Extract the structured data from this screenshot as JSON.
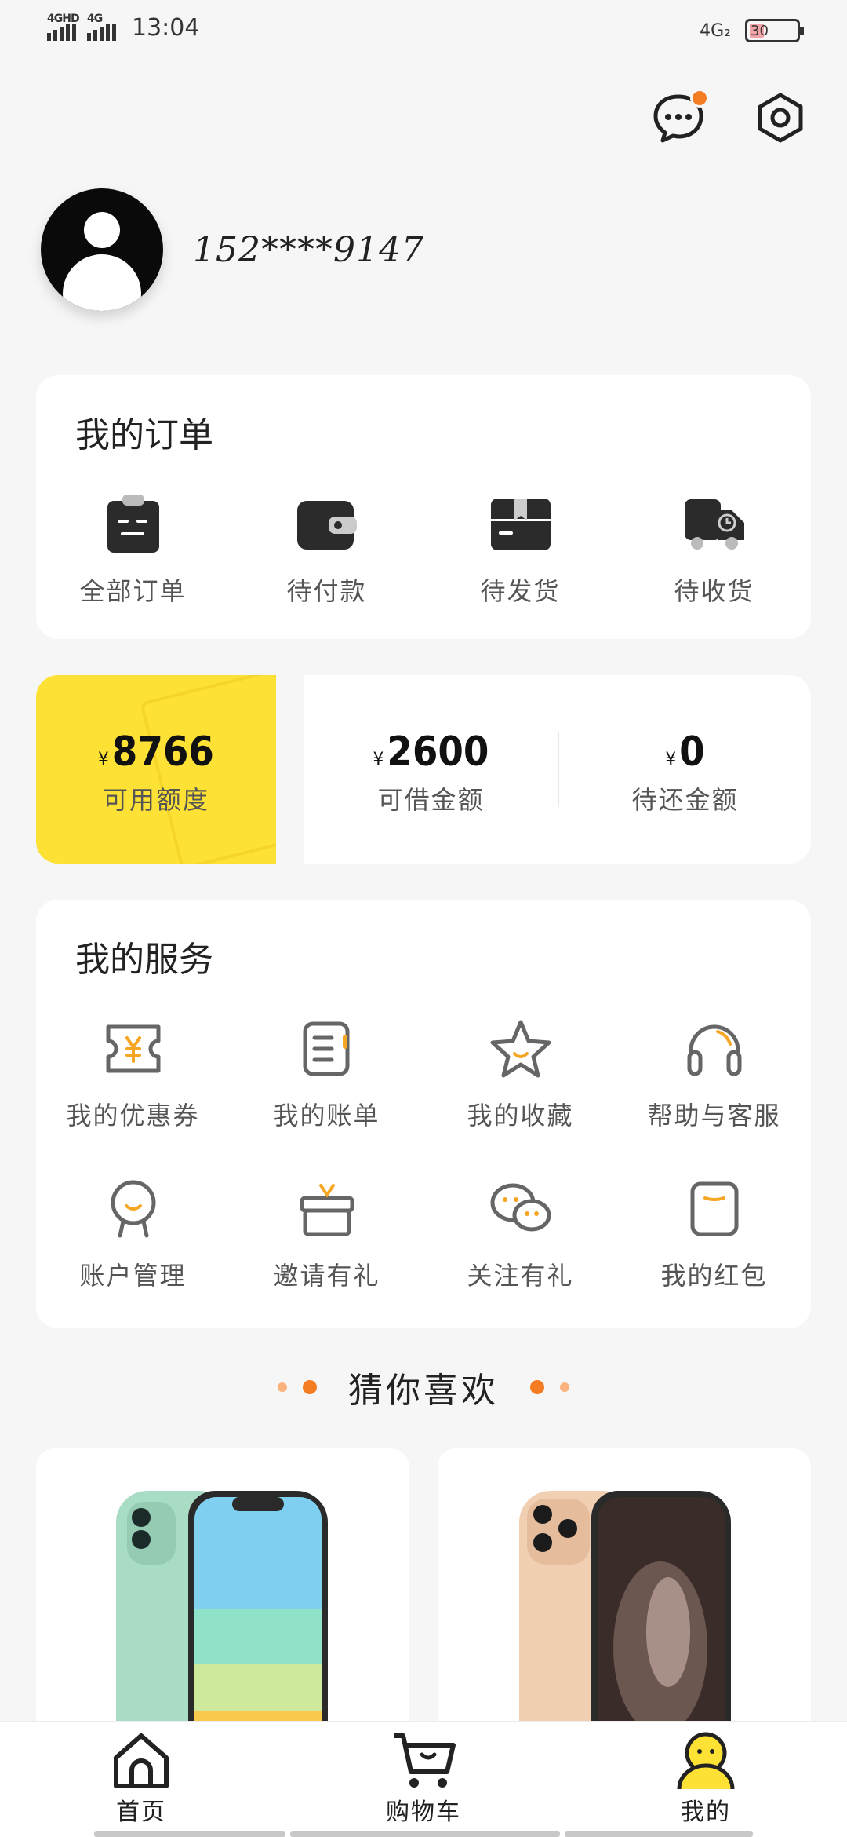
{
  "status_bar": {
    "net1": "4GHD",
    "net2": "4G",
    "time": "13:04",
    "net_right": "4G₂",
    "battery": "30"
  },
  "header": {
    "message_icon": "chat-bubble-icon",
    "settings_icon": "hexagon-settings-icon",
    "has_message_badge": true
  },
  "profile": {
    "phone": "152****9147"
  },
  "orders": {
    "title": "我的订单",
    "items": [
      {
        "label": "全部订单",
        "icon": "clipboard-icon"
      },
      {
        "label": "待付款",
        "icon": "wallet-icon"
      },
      {
        "label": "待发货",
        "icon": "box-icon"
      },
      {
        "label": "待收货",
        "icon": "truck-icon"
      }
    ]
  },
  "credit": {
    "currency": "¥",
    "available": {
      "value": "8766",
      "label": "可用额度"
    },
    "borrowable": {
      "value": "2600",
      "label": "可借金额"
    },
    "to_repay": {
      "value": "0",
      "label": "待还金额"
    }
  },
  "services": {
    "title": "我的服务",
    "items": [
      {
        "label": "我的优惠券",
        "icon": "coupon-icon"
      },
      {
        "label": "我的账单",
        "icon": "bill-icon"
      },
      {
        "label": "我的收藏",
        "icon": "star-icon"
      },
      {
        "label": "帮助与客服",
        "icon": "headset-icon"
      },
      {
        "label": "账户管理",
        "icon": "account-icon"
      },
      {
        "label": "邀请有礼",
        "icon": "gift-icon"
      },
      {
        "label": "关注有礼",
        "icon": "wechat-icon"
      },
      {
        "label": "我的红包",
        "icon": "red-packet-icon"
      }
    ]
  },
  "recommend": {
    "title": "猜你喜欢"
  },
  "products": [
    {
      "image": "green-smartphone"
    },
    {
      "image": "gold-smartphone"
    }
  ],
  "tabbar": {
    "items": [
      {
        "label": "首页",
        "icon": "home-icon"
      },
      {
        "label": "购物车",
        "icon": "cart-icon"
      },
      {
        "label": "我的",
        "icon": "profile-icon"
      }
    ]
  },
  "colors": {
    "accent": "#f57c22",
    "credit_yellow": "#fde235",
    "icon_dark": "#2b2b2b",
    "icon_gray": "#666666"
  }
}
